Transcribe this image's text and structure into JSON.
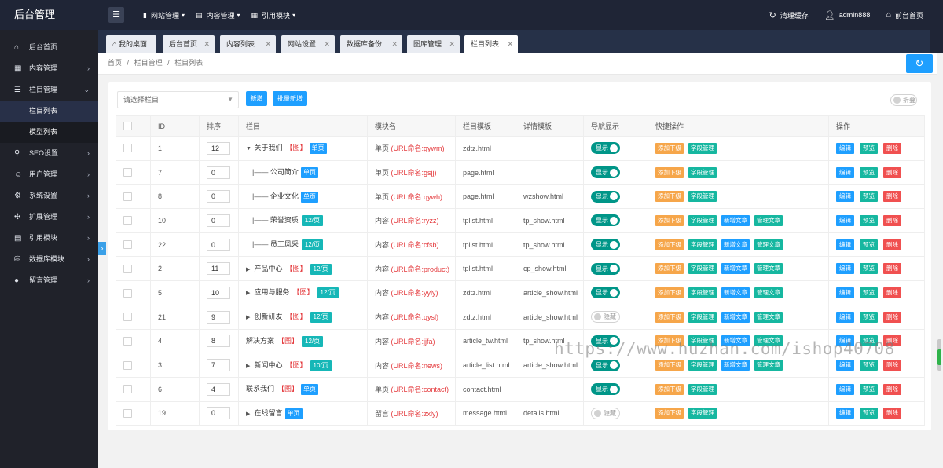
{
  "app": {
    "title": "后台管理"
  },
  "topnav": [
    {
      "icon": "document-icon",
      "label": "网站管理"
    },
    {
      "icon": "list-icon",
      "label": "内容管理"
    },
    {
      "icon": "grid-icon",
      "label": "引用模块"
    }
  ],
  "topright": [
    {
      "icon": "refresh-icon",
      "label": "清理缓存"
    },
    {
      "icon": "user-icon",
      "label": "admin888"
    },
    {
      "icon": "home-icon",
      "label": "前台首页"
    }
  ],
  "sidebar": {
    "items": [
      {
        "icon": "home-icon",
        "label": "后台首页",
        "arrow": false
      },
      {
        "icon": "apps-icon",
        "label": "内容管理",
        "arrow": true
      },
      {
        "icon": "menu-icon",
        "label": "栏目管理",
        "arrow": true
      },
      {
        "icon": "seo-icon",
        "label": "SEO设置",
        "arrow": true
      },
      {
        "icon": "user-icon",
        "label": "用户管理",
        "arrow": true
      },
      {
        "icon": "gear-icon",
        "label": "系统设置",
        "arrow": true
      },
      {
        "icon": "extension-icon",
        "label": "扩展管理",
        "arrow": true
      },
      {
        "icon": "module-icon",
        "label": "引用模块",
        "arrow": true
      },
      {
        "icon": "database-icon",
        "label": "数据库模块",
        "arrow": true
      },
      {
        "icon": "message-icon",
        "label": "留言管理",
        "arrow": true
      }
    ],
    "subitems": [
      {
        "label": "栏目列表",
        "active": true
      },
      {
        "label": "模型列表",
        "active": false
      }
    ]
  },
  "tabs": [
    {
      "label": "我的桌面",
      "closable": false,
      "active": false
    },
    {
      "label": "后台首页",
      "closable": true,
      "active": false
    },
    {
      "label": "内容列表",
      "closable": true,
      "active": false
    },
    {
      "label": "网站设置",
      "closable": true,
      "active": false
    },
    {
      "label": "数据库备份",
      "closable": true,
      "active": false
    },
    {
      "label": "图库管理",
      "closable": true,
      "active": false
    },
    {
      "label": "栏目列表",
      "closable": true,
      "active": true
    }
  ],
  "breadcrumb": [
    "首页",
    "栏目管理",
    "栏目列表"
  ],
  "breadcrumb_sep": "/",
  "toolbar": {
    "select_placeholder": "请选择栏目",
    "add_label": "新增",
    "batch_add_label": "批量新增",
    "fold_label": "折叠"
  },
  "table": {
    "headers": [
      "",
      "ID",
      "排序",
      "栏目",
      "模块名",
      "栏目模板",
      "详情模板",
      "导航显示",
      "快捷操作",
      "操作"
    ],
    "nav_on_label": "显示",
    "nav_off_label": "隐藏",
    "quick_labels": {
      "add_sub": "添加下级",
      "fields": "字段管理",
      "new_article": "新增文章",
      "manage_article": "管理文章"
    },
    "op_labels": {
      "edit": "编辑",
      "preview": "预览",
      "delete": "删除"
    },
    "rows": [
      {
        "id": "1",
        "sort": "12",
        "prefix": "",
        "tri": "▼",
        "name": "关于我们",
        "img": "【图】",
        "tag": "单页",
        "tag_style": "blue",
        "module": "单页",
        "url": "(URL命名:gywm)",
        "tpl": "zdtz.html",
        "detail": "",
        "nav": true,
        "article_btns": false
      },
      {
        "id": "7",
        "sort": "0",
        "prefix": "|—— ",
        "tri": "",
        "name": "公司简介",
        "img": "",
        "tag": "单页",
        "tag_style": "blue",
        "module": "单页",
        "url": "(URL命名:gsjj)",
        "tpl": "page.html",
        "detail": "",
        "nav": true,
        "article_btns": false
      },
      {
        "id": "8",
        "sort": "0",
        "prefix": "|—— ",
        "tri": "",
        "name": "企业文化",
        "img": "",
        "tag": "单页",
        "tag_style": "blue",
        "module": "单页",
        "url": "(URL命名:qywh)",
        "tpl": "page.html",
        "detail": "wzshow.html",
        "nav": true,
        "article_btns": false
      },
      {
        "id": "10",
        "sort": "0",
        "prefix": "|—— ",
        "tri": "",
        "name": "荣誉资质",
        "img": "",
        "tag": "12/页",
        "tag_style": "teal",
        "module": "内容",
        "url": "(URL命名:ryzz)",
        "tpl": "tplist.html",
        "detail": "tp_show.html",
        "nav": true,
        "article_btns": true
      },
      {
        "id": "22",
        "sort": "0",
        "prefix": "|—— ",
        "tri": "",
        "name": "员工风采",
        "img": "",
        "tag": "12/页",
        "tag_style": "teal",
        "module": "内容",
        "url": "(URL命名:cfsb)",
        "tpl": "tplist.html",
        "detail": "tp_show.html",
        "nav": true,
        "article_btns": true
      },
      {
        "id": "2",
        "sort": "11",
        "prefix": "",
        "tri": "▶",
        "name": "产品中心",
        "img": "【图】",
        "tag": "12/页",
        "tag_style": "teal",
        "module": "内容",
        "url": "(URL命名:product)",
        "tpl": "tplist.html",
        "detail": "cp_show.html",
        "nav": true,
        "article_btns": true
      },
      {
        "id": "5",
        "sort": "10",
        "prefix": "",
        "tri": "▶",
        "name": "应用与服务",
        "img": "【图】",
        "tag": "12/页",
        "tag_style": "teal",
        "module": "内容",
        "url": "(URL命名:yyly)",
        "tpl": "zdtz.html",
        "detail": "article_show.html",
        "nav": true,
        "article_btns": true
      },
      {
        "id": "21",
        "sort": "9",
        "prefix": "",
        "tri": "▶",
        "name": "创新研发",
        "img": "【图】",
        "tag": "12/页",
        "tag_style": "teal",
        "module": "内容",
        "url": "(URL命名:qysl)",
        "tpl": "zdtz.html",
        "detail": "article_show.html",
        "nav": false,
        "article_btns": true
      },
      {
        "id": "4",
        "sort": "8",
        "prefix": "",
        "tri": "",
        "name": "解决方案",
        "img": "【图】",
        "tag": "12/页",
        "tag_style": "teal",
        "module": "内容",
        "url": "(URL命名:jjfa)",
        "tpl": "article_tw.html",
        "detail": "tp_show.html",
        "nav": true,
        "article_btns": true
      },
      {
        "id": "3",
        "sort": "7",
        "prefix": "",
        "tri": "▶",
        "name": "新闻中心",
        "img": "【图】",
        "tag": "10/页",
        "tag_style": "teal",
        "module": "内容",
        "url": "(URL命名:news)",
        "tpl": "article_list.html",
        "detail": "article_show.html",
        "nav": true,
        "article_btns": true
      },
      {
        "id": "6",
        "sort": "4",
        "prefix": "",
        "tri": "",
        "name": "联系我们",
        "img": "【图】",
        "tag": "单页",
        "tag_style": "blue",
        "module": "单页",
        "url": "(URL命名:contact)",
        "tpl": "contact.html",
        "detail": "",
        "nav": true,
        "article_btns": false
      },
      {
        "id": "19",
        "sort": "0",
        "prefix": "",
        "tri": "▶",
        "name": "在线留言",
        "img": "",
        "tag": "单页",
        "tag_style": "blue",
        "module": "留言",
        "url": "(URL命名:zxly)",
        "tpl": "message.html",
        "detail": "details.html",
        "nav": false,
        "article_btns": false
      }
    ]
  },
  "watermark": "https://www.huzhan.com/ishop40708",
  "colors": {
    "primary": "#1e9fff",
    "teal": "#16b7a0",
    "orange": "#f6a64a",
    "red": "#f05050",
    "switch_on": "#009688",
    "sidebar": "#20222a",
    "topbar": "#1f2536"
  }
}
